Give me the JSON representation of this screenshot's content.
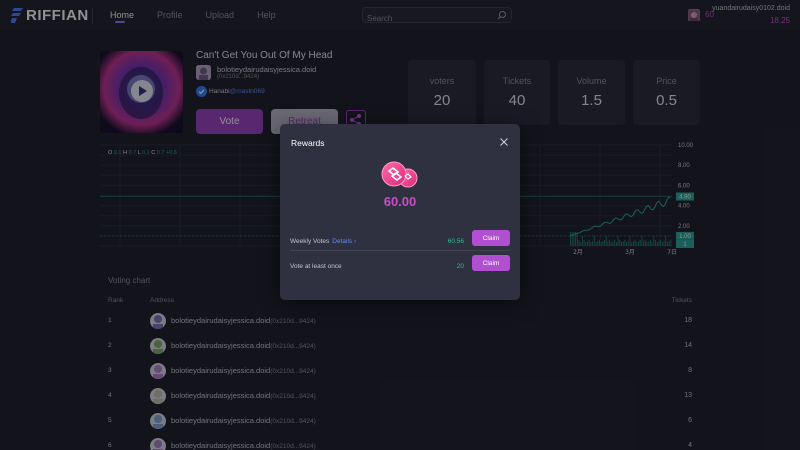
{
  "brand": {
    "name": "RIFFIAN"
  },
  "nav": {
    "items": [
      "Home",
      "Profile",
      "Upload",
      "Help"
    ]
  },
  "search": {
    "placeholder": "Search"
  },
  "user": {
    "votes": "60",
    "name": "yuandairudaisy0102.doid",
    "balance": "18.25"
  },
  "song": {
    "title": "Can't Get You Out Of My Head",
    "artist_name": "bolotieydairudaisyjessica.doid",
    "artist_addr": "(0x210d...9424)",
    "handle_name": "Hanabi",
    "handle_tag": "@mastn069"
  },
  "actions": {
    "vote": "Vote",
    "retreat": "Retreat"
  },
  "stats": [
    {
      "label": "voters",
      "value": "20"
    },
    {
      "label": "Tickets",
      "value": "40"
    },
    {
      "label": "Volume",
      "value": "1.5"
    },
    {
      "label": "Price",
      "value": "0.5"
    }
  ],
  "chart_data": {
    "type": "line",
    "ohlc": {
      "o_label": "O",
      "o": "0.1",
      "h_label": "H",
      "h": "0.7",
      "l_label": "L",
      "l": "0.1",
      "c_label": "C",
      "c": "0.7",
      "change": "+0.6"
    },
    "y_ticks": [
      "10.00",
      "8.00",
      "6.00",
      "4.00",
      "2.00",
      "1.00",
      "0"
    ],
    "x_ticks": [
      "2月",
      "3月",
      "7日"
    ],
    "markers": [
      {
        "label": "4.90",
        "color": "#26a69a"
      },
      {
        "label": "1.00",
        "color": "#26a69a"
      },
      {
        "label": "1",
        "color": "#26a69a"
      }
    ],
    "y_range": [
      0,
      10
    ],
    "series": [
      {
        "x": [
          "2月",
          "3月",
          "7日"
        ],
        "values": [
          1.0,
          2.6,
          4.9
        ]
      }
    ]
  },
  "voting": {
    "title": "Voting chart",
    "headers": {
      "rank": "Rank",
      "address": "Address",
      "tickets": "Tickets"
    },
    "rows": [
      {
        "rank": "1",
        "name": "bolotieydairudaisyjessica.doid",
        "addr": "(0x210d...9424)",
        "tickets": "18"
      },
      {
        "rank": "2",
        "name": "bolotieydairudaisyjessica.doid",
        "addr": "(0x210d...9424)",
        "tickets": "14"
      },
      {
        "rank": "3",
        "name": "bolotieydairudaisyjessica.doid",
        "addr": "(0x210d...9424)",
        "tickets": "8"
      },
      {
        "rank": "4",
        "name": "bolotieydairudaisyjessica.doid",
        "addr": "(0x210d...9424)",
        "tickets": "13"
      },
      {
        "rank": "5",
        "name": "bolotieydairudaisyjessica.doid",
        "addr": "(0x210d...9424)",
        "tickets": "6"
      },
      {
        "rank": "6",
        "name": "bolotieydairudaisyjessica.doid",
        "addr": "(0x210d...9424)",
        "tickets": "4"
      }
    ]
  },
  "modal": {
    "title": "Rewards",
    "amount": "60.00",
    "rows": [
      {
        "label": "Weekly Votes",
        "link": "Details",
        "value": "60.56",
        "button": "Claim"
      },
      {
        "label": "Vote at least once",
        "link": "",
        "value": "20",
        "button": "Claim"
      }
    ]
  },
  "icons": {
    "search": "search-icon",
    "share": "share-icon",
    "close": "close-icon",
    "verify": "verified-icon",
    "play": "play-icon"
  },
  "colors": {
    "accent": "#9a3fbf",
    "green": "#26a69a",
    "link": "#5b8cff"
  }
}
